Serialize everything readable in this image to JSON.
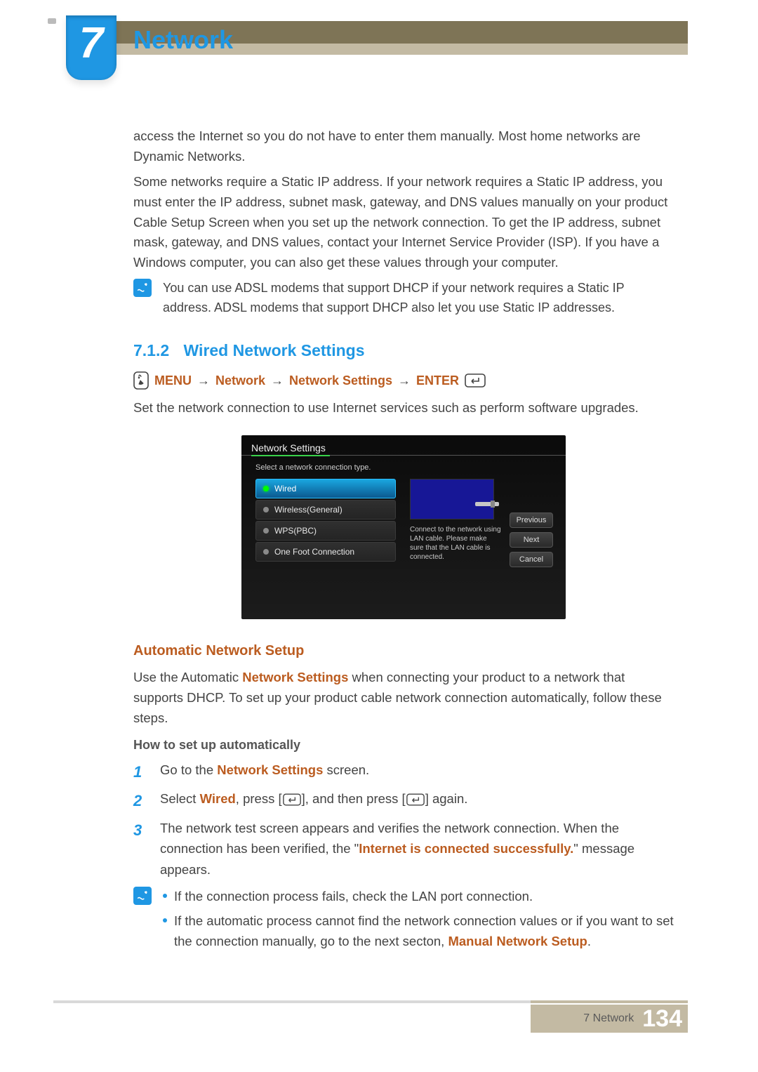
{
  "chapter": {
    "number": "7",
    "title": "Network"
  },
  "intro": {
    "p1": "access the Internet so you do not have to enter them manually. Most home networks are Dynamic Networks.",
    "p2": "Some networks require a Static IP address. If your network requires a Static IP address, you must enter the IP address, subnet mask, gateway, and DNS values manually on your product Cable Setup Screen when you set up the network connection. To get the IP address, subnet mask, gateway, and DNS values, contact your Internet Service Provider (ISP). If you have a Windows computer, you can also get these values through your computer.",
    "note": "You can use ADSL modems that support DHCP if your network requires a Static IP address. ADSL modems that support DHCP also let you use Static IP addresses."
  },
  "section": {
    "num": "7.1.2",
    "title": "Wired Network Settings",
    "path": {
      "menu": "MENU",
      "a": "Network",
      "b": "Network Settings",
      "enter": "ENTER",
      "arrow": "→"
    },
    "desc": "Set the network connection to use Internet services such as perform software upgrades."
  },
  "screenshot": {
    "title": "Network Settings",
    "subtitle": "Select a network connection type.",
    "options": [
      "Wired",
      "Wireless(General)",
      "WPS(PBC)",
      "One Foot Connection"
    ],
    "help": "Connect to the network using LAN cable. Please make sure that the LAN cable is connected.",
    "buttons": [
      "Previous",
      "Next",
      "Cancel"
    ]
  },
  "auto": {
    "title": "Automatic Network Setup",
    "p_pre": "Use the Automatic ",
    "p_kw": "Network Settings",
    "p_post": " when connecting your product to a network that supports DHCP. To set up your product cable network connection automatically, follow these steps.",
    "howto_title": "How to set up automatically",
    "steps": {
      "s1a": "Go to the ",
      "s1kw": "Network Settings",
      "s1b": " screen.",
      "s2a": "Select ",
      "s2kw": "Wired",
      "s2b": ", press [",
      "s2c": "], and then press [",
      "s2d": "] again.",
      "s3a": "The network test screen appears and verifies the network connection. When the connection has been verified, the \"",
      "s3kw": "Internet is connected successfully.",
      "s3b": "\" message appears."
    },
    "tips": {
      "t1": "If the connection process fails, check the LAN port connection.",
      "t2a": "If the automatic process cannot find the network connection values or if you want to set the connection manually, go to the next secton, ",
      "t2kw": "Manual Network Setup",
      "t2b": "."
    }
  },
  "footer": {
    "label": "7 Network",
    "page": "134"
  }
}
